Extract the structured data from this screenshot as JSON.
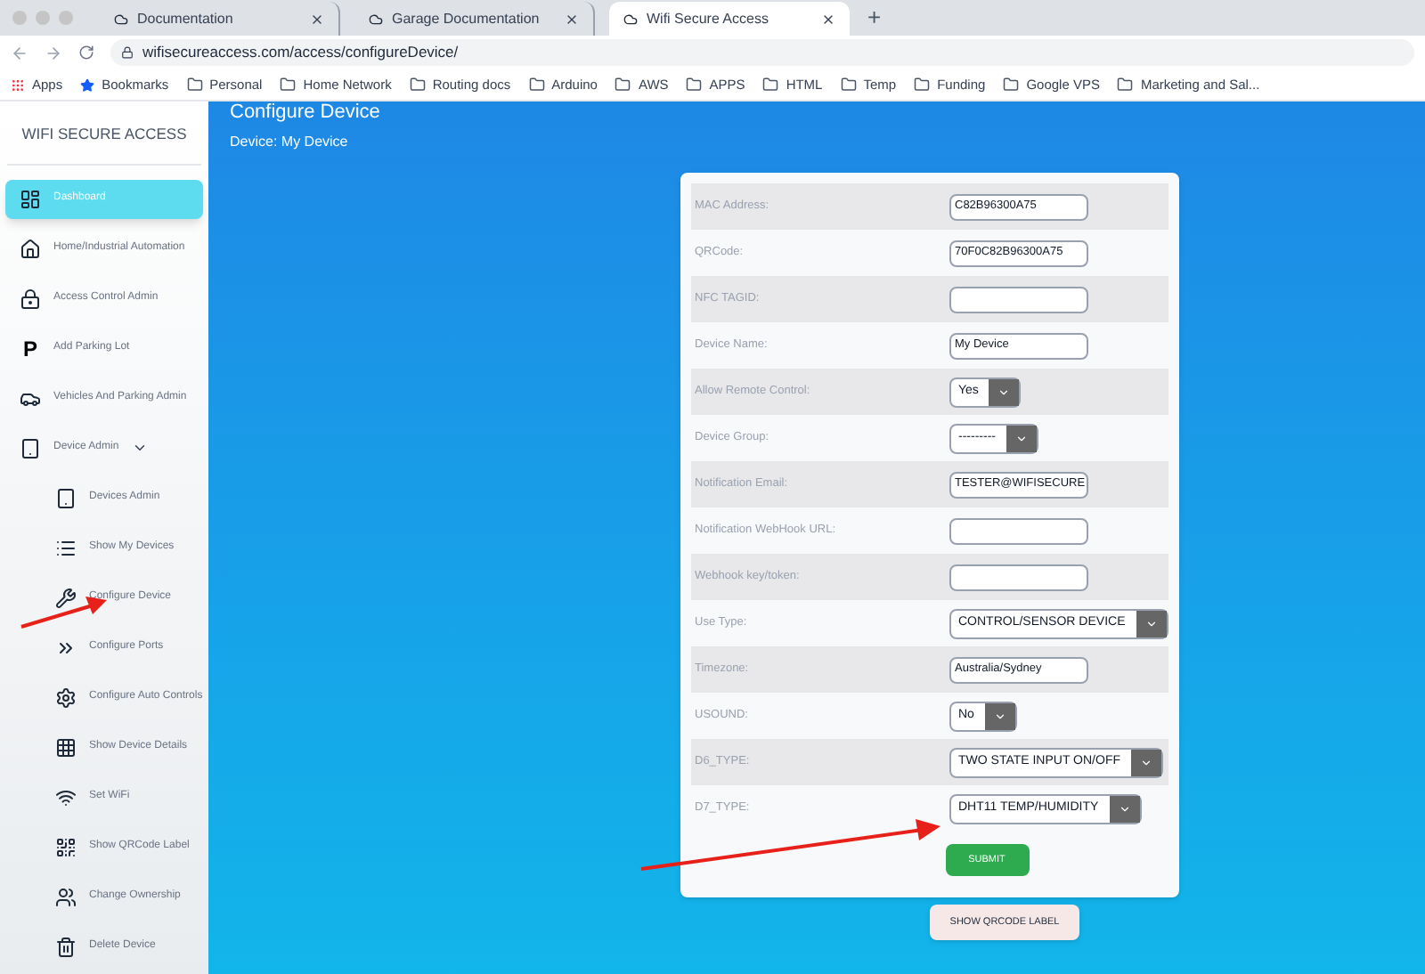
{
  "browser": {
    "tabs": [
      {
        "title": "Documentation",
        "selected": false
      },
      {
        "title": "Garage Documentation",
        "selected": false
      },
      {
        "title": "Wifi Secure Access",
        "selected": true
      }
    ],
    "new_tab": "+",
    "url": "wifisecureaccess.com/access/configureDevice/",
    "bookmarks": [
      {
        "label": "Apps",
        "kind": "apps"
      },
      {
        "label": "Bookmarks",
        "kind": "star"
      },
      {
        "label": "Personal",
        "kind": "folder"
      },
      {
        "label": "Home Network",
        "kind": "folder"
      },
      {
        "label": "Routing docs",
        "kind": "folder"
      },
      {
        "label": "Arduino",
        "kind": "folder"
      },
      {
        "label": "AWS",
        "kind": "folder"
      },
      {
        "label": "APPS",
        "kind": "folder"
      },
      {
        "label": "HTML",
        "kind": "folder"
      },
      {
        "label": "Temp",
        "kind": "folder"
      },
      {
        "label": "Funding",
        "kind": "folder"
      },
      {
        "label": "Google VPS",
        "kind": "folder"
      },
      {
        "label": "Marketing and Sal...",
        "kind": "folder"
      }
    ]
  },
  "sidebar": {
    "title": "WIFI SECURE ACCESS",
    "items": [
      {
        "label": "Dashboard",
        "selected": true
      },
      {
        "label": "Home/Industrial Automation",
        "selected": false
      },
      {
        "label": "Access Control Admin",
        "selected": false
      },
      {
        "label": "Add Parking Lot",
        "icon_glyph": "P",
        "selected": false
      },
      {
        "label": "Vehicles And Parking Admin",
        "selected": false
      },
      {
        "label": "Device Admin",
        "selected": false,
        "expanded": true,
        "children": [
          {
            "label": "Devices Admin",
            "selected": false
          },
          {
            "label": "Show My Devices",
            "selected": false
          },
          {
            "label": "Configure Device",
            "selected": false
          },
          {
            "label": "Configure Ports",
            "selected": false
          },
          {
            "label": "Configure Auto Controls",
            "selected": false
          },
          {
            "label": "Show Device Details",
            "selected": false
          },
          {
            "label": "Set WiFi",
            "selected": false
          },
          {
            "label": "Show QRCode Label",
            "selected": false
          },
          {
            "label": "Change Ownership",
            "selected": false
          },
          {
            "label": "Delete Device",
            "selected": false
          }
        ]
      }
    ]
  },
  "page": {
    "title": "Configure Device",
    "subtitle": "Device: My Device"
  },
  "form": {
    "rows": [
      {
        "label": "MAC Address:",
        "kind": "text",
        "value": "C82B96300A75"
      },
      {
        "label": "QRCode:",
        "kind": "text",
        "value": "70F0C82B96300A75"
      },
      {
        "label": "NFC TAGID:",
        "kind": "text",
        "value": ""
      },
      {
        "label": "Device Name:",
        "kind": "text",
        "value": "My Device"
      },
      {
        "label": "Allow Remote Control:",
        "kind": "select",
        "value": "Yes"
      },
      {
        "label": "Device Group:",
        "kind": "select",
        "value": "---------"
      },
      {
        "label": "Notification Email:",
        "kind": "text",
        "value": "TESTER@WIFISECURE"
      },
      {
        "label": "Notification WebHook URL:",
        "kind": "text",
        "value": ""
      },
      {
        "label": "Webhook key/token:",
        "kind": "text",
        "value": ""
      },
      {
        "label": "Use Type:",
        "kind": "select",
        "value": "CONTROL/SENSOR DEVICE"
      },
      {
        "label": "Timezone:",
        "kind": "text",
        "value": "Australia/Sydney"
      },
      {
        "label": "USOUND:",
        "kind": "select",
        "value": "No"
      },
      {
        "label": "D6_TYPE:",
        "kind": "select",
        "value": "TWO STATE INPUT ON/OFF"
      },
      {
        "label": "D7_TYPE:",
        "kind": "select",
        "value": "DHT11 TEMP/HUMIDITY"
      }
    ],
    "submit": "SUBMIT"
  },
  "qr_button": "SHOW QRCODE LABEL"
}
